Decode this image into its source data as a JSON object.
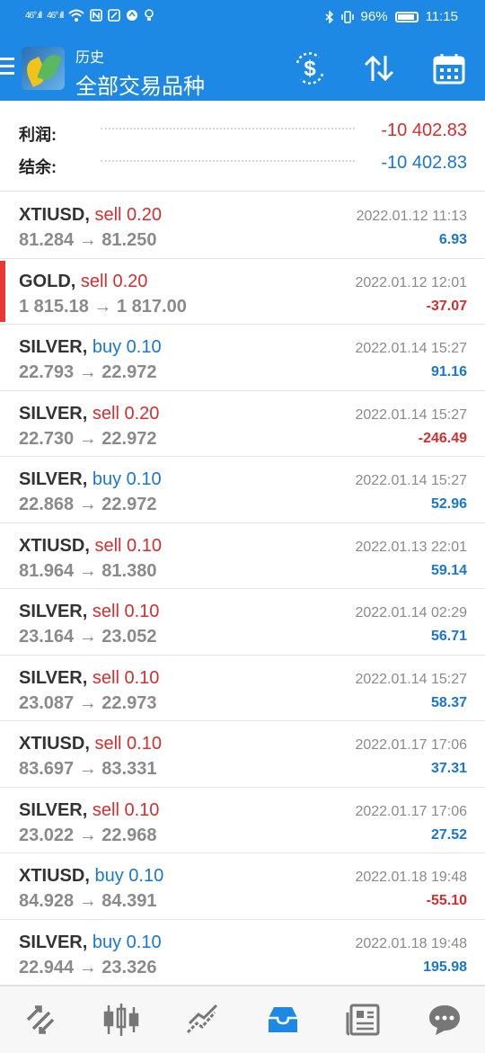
{
  "statusbar": {
    "signal1": "46°.ıll",
    "signal2": "46°.ıll",
    "battery": "96%",
    "time": "11:15"
  },
  "header": {
    "subtitle": "历史",
    "title": "全部交易品种",
    "icons": [
      "menu-icon",
      "exchange-dollar-icon",
      "sort-icon",
      "calendar-icon"
    ]
  },
  "summary": {
    "profit_label": "利润:",
    "profit_value": "-10 402.83",
    "balance_label": "结余:",
    "balance_value": "-10 402.83"
  },
  "trades": [
    {
      "symbol": "XTIUSD,",
      "side": "sell 0.20",
      "prices": "81.284 → 81.250",
      "time": "2022.01.12 11:13",
      "profit": "6.93"
    },
    {
      "symbol": "GOLD,",
      "side": "sell 0.20",
      "prices": "1 815.18 → 1 817.00",
      "time": "2022.01.12 12:01",
      "profit": "-37.07"
    },
    {
      "symbol": "SILVER,",
      "side": "buy 0.10",
      "prices": "22.793 → 22.972",
      "time": "2022.01.14 15:27",
      "profit": "91.16"
    },
    {
      "symbol": "SILVER,",
      "side": "sell 0.20",
      "prices": "22.730 → 22.972",
      "time": "2022.01.14 15:27",
      "profit": "-246.49"
    },
    {
      "symbol": "SILVER,",
      "side": "buy 0.10",
      "prices": "22.868 → 22.972",
      "time": "2022.01.14 15:27",
      "profit": "52.96"
    },
    {
      "symbol": "XTIUSD,",
      "side": "sell 0.10",
      "prices": "81.964 → 81.380",
      "time": "2022.01.13 22:01",
      "profit": "59.14"
    },
    {
      "symbol": "SILVER,",
      "side": "sell 0.10",
      "prices": "23.164 → 23.052",
      "time": "2022.01.14 02:29",
      "profit": "56.71"
    },
    {
      "symbol": "SILVER,",
      "side": "sell 0.10",
      "prices": "23.087 → 22.973",
      "time": "2022.01.14 15:27",
      "profit": "58.37"
    },
    {
      "symbol": "XTIUSD,",
      "side": "sell 0.10",
      "prices": "83.697 → 83.331",
      "time": "2022.01.17 17:06",
      "profit": "37.31"
    },
    {
      "symbol": "SILVER,",
      "side": "sell 0.10",
      "prices": "23.022 → 22.968",
      "time": "2022.01.17 17:06",
      "profit": "27.52"
    },
    {
      "symbol": "XTIUSD,",
      "side": "buy 0.10",
      "prices": "84.928 → 84.391",
      "time": "2022.01.18 19:48",
      "profit": "-55.10"
    },
    {
      "symbol": "SILVER,",
      "side": "buy 0.10",
      "prices": "22.944 → 23.326",
      "time": "2022.01.18 19:48",
      "profit": "195.98"
    }
  ],
  "bottom_nav": [
    "quotes-icon",
    "chart-candles-icon",
    "trade-icon",
    "history-inbox-icon",
    "news-icon",
    "chat-icon"
  ],
  "colors": {
    "accent": "#1e88e5",
    "sell": "#d32f2f",
    "buy": "#1976d2",
    "selected_marker": "#e53935"
  }
}
